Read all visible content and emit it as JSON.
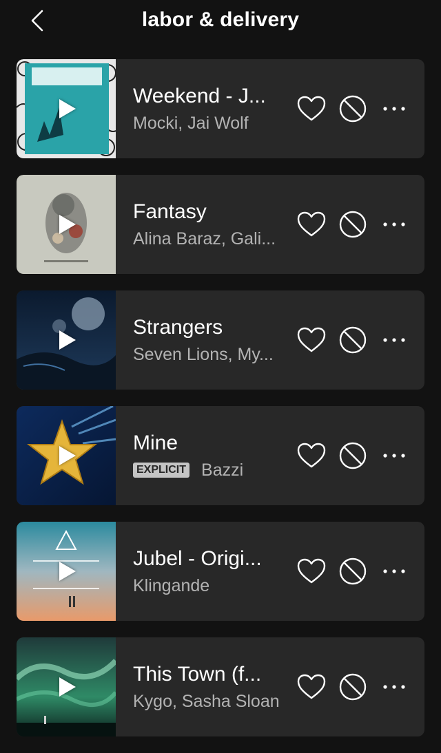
{
  "header": {
    "title": "labor & delivery",
    "back_icon": "chevron-left-icon"
  },
  "tracks": [
    {
      "title": "Weekend - J...",
      "artist": "Mocki, Jai Wolf",
      "explicit": false,
      "cover": "mocki-weekend"
    },
    {
      "title": "Fantasy",
      "artist": "Alina Baraz, Gali...",
      "explicit": false,
      "cover": "urban-flora"
    },
    {
      "title": "Strangers",
      "artist": "Seven Lions, My...",
      "explicit": false,
      "cover": "seven-lions"
    },
    {
      "title": "Mine",
      "artist": "Bazzi",
      "explicit": true,
      "explicit_label": "EXPLICIT",
      "cover": "star"
    },
    {
      "title": "Jubel - Origi...",
      "artist": "Klingande",
      "explicit": false,
      "cover": "klingande-jubel"
    },
    {
      "title": "This Town (f...",
      "artist": "Kygo, Sasha Sloan",
      "explicit": false,
      "cover": "kygo-stargazing"
    }
  ],
  "colors": {
    "background": "#121212",
    "card": "#282828",
    "text": "#ffffff",
    "subtext": "#b3b3b3",
    "explicit_badge": "#c4c4c4"
  },
  "icons": {
    "play": "play-icon",
    "like": "heart-icon",
    "hide": "block-icon",
    "more": "more-icon"
  }
}
